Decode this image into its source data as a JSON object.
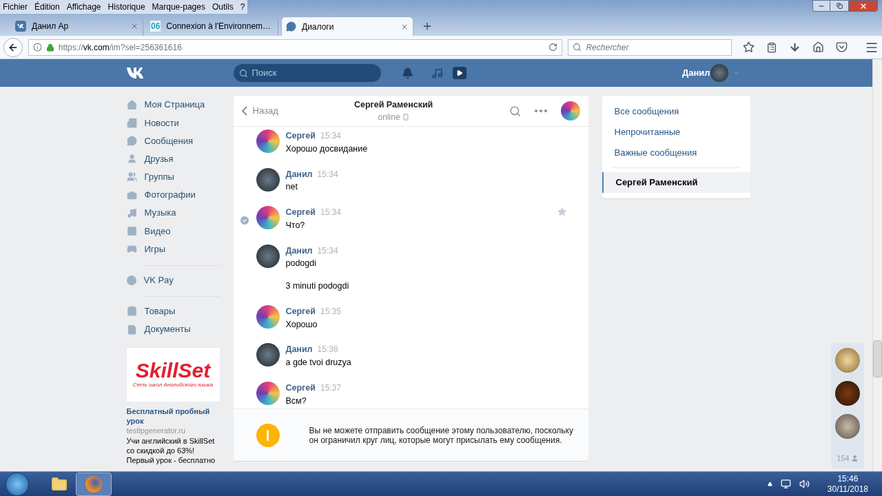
{
  "browser": {
    "menu": [
      "Fichier",
      "Édition",
      "Affichage",
      "Historique",
      "Marque-pages",
      "Outils",
      "?"
    ],
    "tabs": [
      {
        "title": "Данил Ар",
        "kind": "vk",
        "selected": false
      },
      {
        "title": "Connexion à l'Environnem…",
        "kind": "badge",
        "badge": "06",
        "selected": false
      },
      {
        "title": "Диалоги",
        "kind": "chat",
        "selected": true
      }
    ],
    "url": "https://**vk.com**/im?sel=256361616",
    "search_placeholder": "Rechercher"
  },
  "header": {
    "search_placeholder": "Поиск",
    "user": "Данил"
  },
  "sidebar": {
    "sections": [
      [
        {
          "label": "Моя Страница"
        },
        {
          "label": "Новости"
        },
        {
          "label": "Сообщения"
        },
        {
          "label": "Друзья"
        },
        {
          "label": "Группы"
        },
        {
          "label": "Фотографии"
        },
        {
          "label": "Музыка"
        },
        {
          "label": "Видео"
        },
        {
          "label": "Игры"
        }
      ],
      [
        {
          "label": "VK Pay"
        }
      ],
      [
        {
          "label": "Товары"
        },
        {
          "label": "Документы"
        }
      ]
    ]
  },
  "ad": {
    "brand": "SkillSet",
    "tagline": "Сеть школ Английского языка",
    "title": "Бесплатный пробный урок",
    "domain": "testlpgenerator.ru",
    "text": "Учи английский в SkillSet со скидкой до 63%! Первый урок - бесплатно"
  },
  "chat": {
    "back": "Назад",
    "name": "Сергей Раменский",
    "status": "online",
    "messages": [
      {
        "author": "Сергей",
        "kind": "lion",
        "time": "15:34",
        "texts": [
          "Хорошо досвидание"
        ],
        "selected": false
      },
      {
        "author": "Данил",
        "kind": "dark",
        "time": "15:34",
        "texts": [
          "net"
        ],
        "selected": false
      },
      {
        "author": "Сергей",
        "kind": "lion",
        "time": "15:34",
        "texts": [
          "Что?"
        ],
        "selected": true
      },
      {
        "author": "Данил",
        "kind": "dark",
        "time": "15:34",
        "texts": [
          "podogdi",
          "3 minuti podogdi"
        ],
        "selected": false
      },
      {
        "author": "Сергей",
        "kind": "lion",
        "time": "15:35",
        "texts": [
          "Хорошо"
        ],
        "selected": false
      },
      {
        "author": "Данил",
        "kind": "dark",
        "time": "15:36",
        "texts": [
          "a gde tvoi druzya"
        ],
        "selected": false
      },
      {
        "author": "Сергей",
        "kind": "lion",
        "time": "15:37",
        "texts": [
          "Всм?"
        ],
        "selected": false
      }
    ],
    "notice": "Вы не можете отправить сообщение этому пользователю, поскольку он ограничил круг лиц, которые могут присылать ему сообщения."
  },
  "filters": [
    {
      "label": "Все сообщения",
      "selected": false
    },
    {
      "label": "Непрочитанные",
      "selected": false
    },
    {
      "label": "Важные сообщения",
      "selected": false
    },
    {
      "label": "Сергей Раменский",
      "selected": true
    }
  ],
  "friends": {
    "count": "154"
  },
  "taskbar": {
    "time": "15:46",
    "date": "30/11/2018"
  }
}
